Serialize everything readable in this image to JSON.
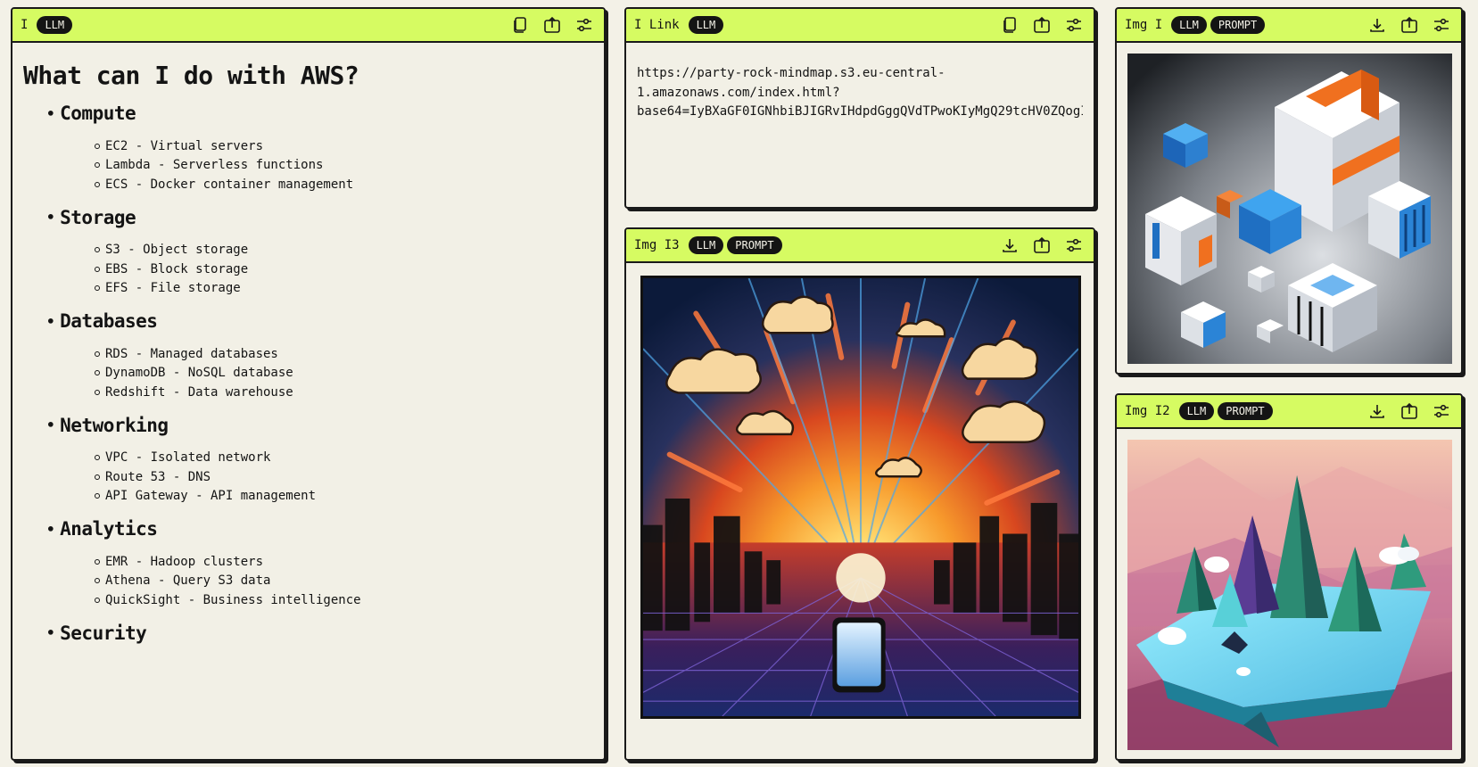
{
  "main_widget": {
    "title": "I",
    "badges": [
      "LLM"
    ],
    "heading": "What can I do with AWS?",
    "sections": [
      {
        "title": "Compute",
        "items": [
          "EC2 - Virtual servers",
          "Lambda - Serverless functions",
          "ECS - Docker container management"
        ]
      },
      {
        "title": "Storage",
        "items": [
          "S3 - Object storage",
          "EBS - Block storage",
          "EFS - File storage"
        ]
      },
      {
        "title": "Databases",
        "items": [
          "RDS - Managed databases",
          "DynamoDB - NoSQL database",
          "Redshift - Data warehouse"
        ]
      },
      {
        "title": "Networking",
        "items": [
          "VPC - Isolated network",
          "Route 53 - DNS",
          "API Gateway - API management"
        ]
      },
      {
        "title": "Analytics",
        "items": [
          "EMR - Hadoop clusters",
          "Athena - Query S3 data",
          "QuickSight - Business intelligence"
        ]
      },
      {
        "title": "Security",
        "items": []
      }
    ]
  },
  "link_widget": {
    "title": "I Link",
    "badges": [
      "LLM"
    ],
    "text_lines": [
      "https://party-rock-mindmap.s3.eu-central-",
      "1.amazonaws.com/index.html?",
      "base64=IyBXaGF0IGNhbiBJIGRvIHdpdGggQVdTPwoKIyMgQ29tcHV0ZQogI"
    ]
  },
  "image_widgets": [
    {
      "id": "img3",
      "title": "Img I3",
      "badges": [
        "LLM",
        "PROMPT"
      ]
    },
    {
      "id": "img1",
      "title": "Img I",
      "badges": [
        "LLM",
        "PROMPT"
      ]
    },
    {
      "id": "img2",
      "title": "Img I2",
      "badges": [
        "LLM",
        "PROMPT"
      ]
    }
  ],
  "icons": {
    "text_tools": [
      "copy-icon",
      "export-icon",
      "settings-sliders-icon"
    ],
    "image_tools": [
      "download-icon",
      "export-icon",
      "settings-sliders-icon"
    ]
  },
  "colors": {
    "header_bg": "#d6fb62",
    "panel_bg": "#f2f0e6",
    "badge_bg": "#141414",
    "border": "#1a1a1a"
  }
}
